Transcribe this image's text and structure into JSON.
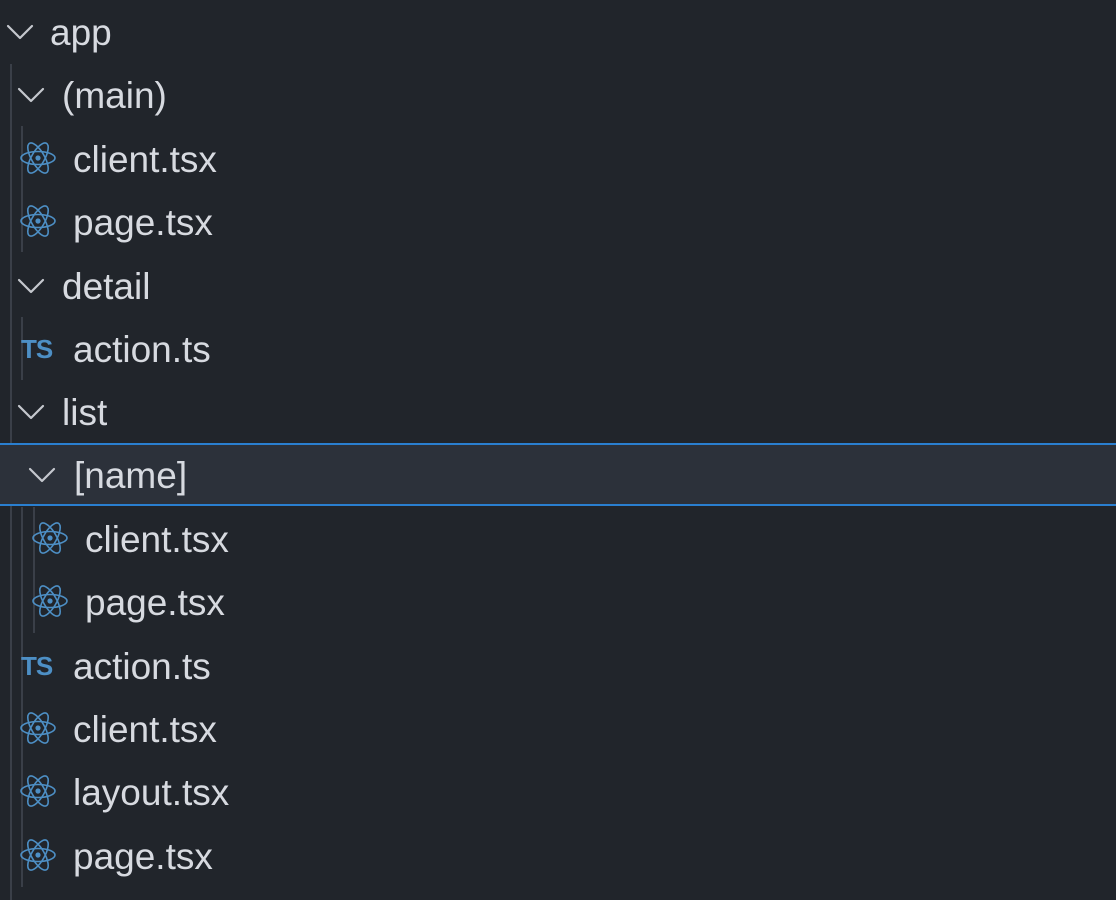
{
  "explorer": {
    "app": {
      "label": "app",
      "main_group": {
        "label": "(main)",
        "files": [
          {
            "label": "client.tsx",
            "icon": "react-icon"
          },
          {
            "label": "page.tsx",
            "icon": "react-icon"
          }
        ]
      },
      "detail": {
        "label": "detail",
        "files": [
          {
            "label": "action.ts",
            "icon": "typescript-icon",
            "icon_text": "TS"
          }
        ]
      },
      "list": {
        "label": "list",
        "name_folder": {
          "label": "[name]",
          "files": [
            {
              "label": "client.tsx",
              "icon": "react-icon"
            },
            {
              "label": "page.tsx",
              "icon": "react-icon"
            }
          ]
        }
      },
      "files": [
        {
          "label": "action.ts",
          "icon": "typescript-icon",
          "icon_text": "TS"
        },
        {
          "label": "client.tsx",
          "icon": "react-icon"
        },
        {
          "label": "layout.tsx",
          "icon": "react-icon"
        },
        {
          "label": "page.tsx",
          "icon": "react-icon"
        }
      ]
    },
    "colors": {
      "background": "#21252b",
      "selection": "#2c313a",
      "selection_border": "#2a7fd0",
      "react_icon": "#4d8fc5",
      "ts_icon": "#4d8fc5",
      "text": "#d7dae0"
    }
  }
}
